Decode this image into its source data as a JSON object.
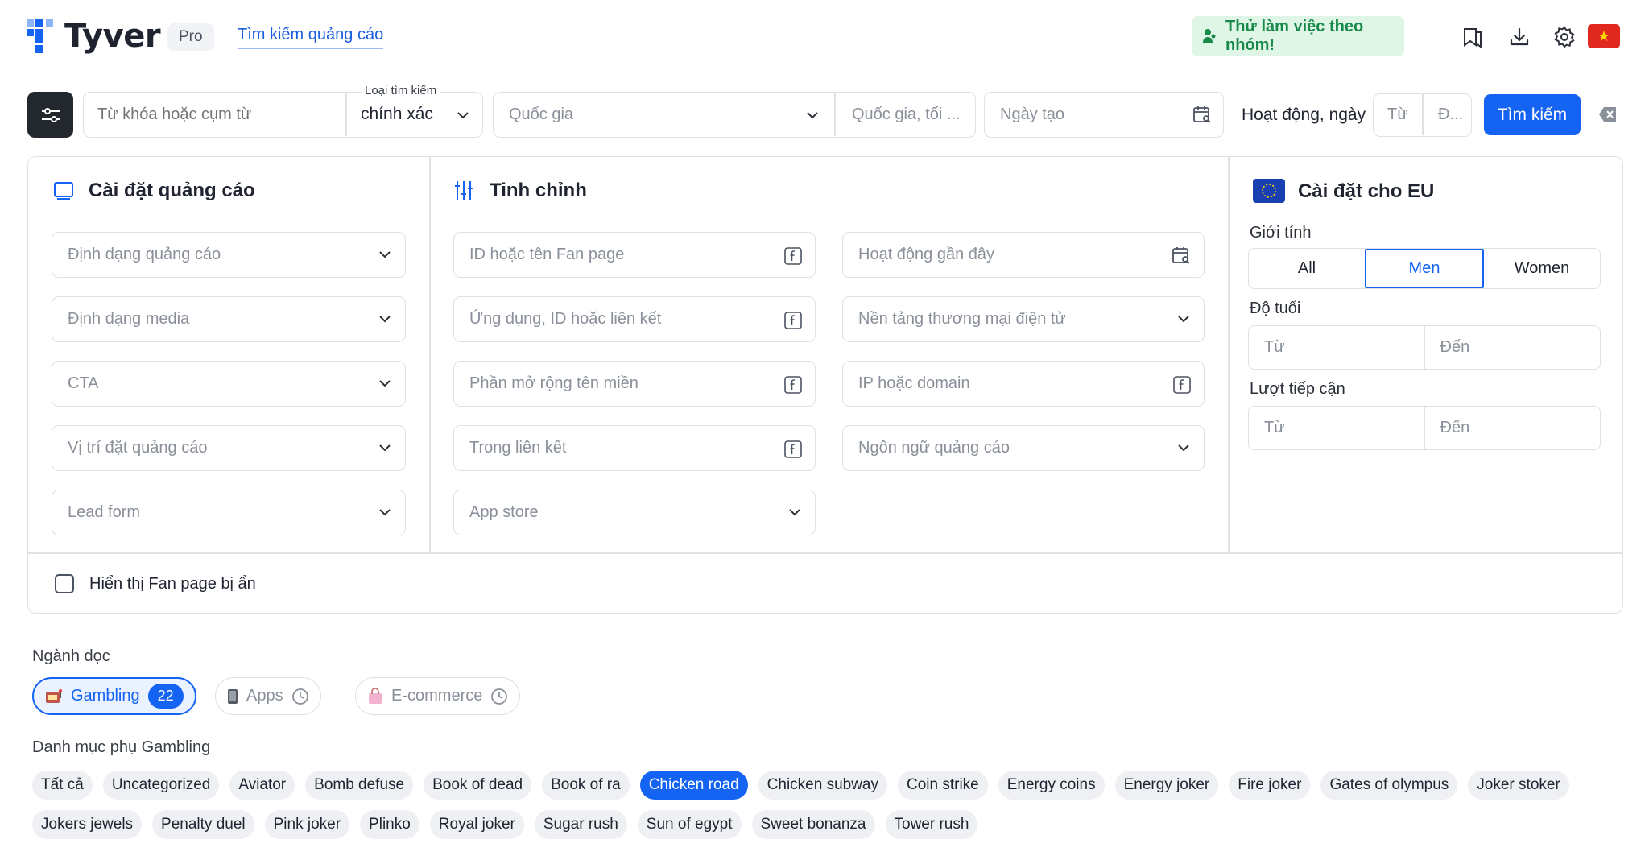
{
  "header": {
    "brand": "Tyver",
    "plan_badge": "Pro",
    "nav_link": "Tìm kiếm quảng cáo",
    "team_cta": "Thử làm việc theo nhóm!",
    "icons": [
      "bookmark-icon",
      "download-icon",
      "gear-icon",
      "vietnam-flag-icon"
    ]
  },
  "search": {
    "keyword_placeholder": "Từ khóa hoặc cụm từ",
    "search_type_label": "Loại tìm kiếm",
    "search_type_value": "chính xác",
    "country_placeholder": "Quốc gia",
    "country_extra_placeholder": "Quốc gia, tối ...",
    "created_date_placeholder": "Ngày tạo",
    "activity_label": "Hoạt động, ngày",
    "activity_from": "Từ",
    "activity_to": "Đ...",
    "search_button": "Tìm kiếm"
  },
  "ad_settings": {
    "title": "Cài đặt quảng cáo",
    "fields": [
      "Định dạng quảng cáo",
      "Định dạng media",
      "CTA",
      "Vị trí đặt quảng cáo",
      "Lead form"
    ]
  },
  "refine": {
    "title": "Tinh chỉnh",
    "col1": [
      "ID hoặc tên Fan page",
      "Ứng dụng, ID hoặc liên kết",
      "Phần mở rộng tên miền",
      "Trong liên kết",
      "App store"
    ],
    "col2": [
      "Hoạt động gần đây",
      "Nền tảng thương mại điện tử",
      "IP hoặc domain",
      "Ngôn ngữ quảng cáo"
    ]
  },
  "eu": {
    "title": "Cài đặt cho EU",
    "gender_label": "Giới tính",
    "gender_options": [
      "All",
      "Men",
      "Women"
    ],
    "gender_selected": "Men",
    "age_label": "Độ tuổi",
    "age_from": "Từ",
    "age_to": "Đến",
    "reach_label": "Lượt tiếp cận",
    "reach_from": "Từ",
    "reach_to": "Đến"
  },
  "hidden_pages_label": "Hiển thị Fan page bị ẩn",
  "verticals": {
    "label": "Ngành dọc",
    "items": [
      {
        "label": "Gambling",
        "count": "22",
        "icon": "slot-machine-icon"
      },
      {
        "label": "Apps",
        "icon": "phone-icon"
      },
      {
        "label": "E-commerce",
        "icon": "shopping-bag-icon"
      }
    ]
  },
  "subcategories": {
    "label": "Danh mục phụ Gambling",
    "selected": "Chicken road",
    "items": [
      "Tất cả",
      "Uncategorized",
      "Aviator",
      "Bomb defuse",
      "Book of dead",
      "Book of ra",
      "Chicken road",
      "Chicken subway",
      "Coin strike",
      "Energy coins",
      "Energy joker",
      "Fire joker",
      "Gates of olympus",
      "Joker stoker",
      "Jokers jewels",
      "Penalty duel",
      "Pink joker",
      "Plinko",
      "Royal joker",
      "Sugar rush",
      "Sun of egypt",
      "Sweet bonanza",
      "Tower rush"
    ]
  },
  "colors": {
    "accent": "#1463f3",
    "team_bg": "#dff5e6",
    "team_text": "#178a4a"
  }
}
